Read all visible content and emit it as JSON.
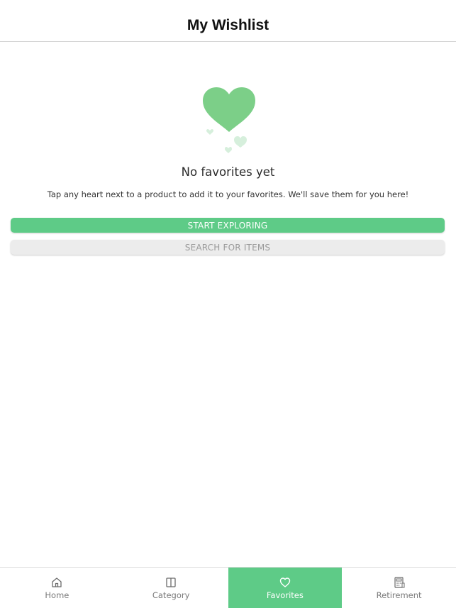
{
  "header": {
    "title": "My Wishlist"
  },
  "empty_state": {
    "title": "No favorites yet",
    "description": "Tap any heart next to a product to add it to your favorites. We'll save them for you here!",
    "heart_color": "#7ccf88"
  },
  "actions": {
    "primary_label": "START EXPLORING",
    "secondary_label": "SEARCH FOR ITEMS"
  },
  "tabbar": {
    "active_color": "#5ecb87",
    "tabs": [
      {
        "label": "Home",
        "icon": "home-icon",
        "active": false
      },
      {
        "label": "Category",
        "icon": "category-icon",
        "active": false
      },
      {
        "label": "Favorites",
        "icon": "heart-icon",
        "active": true
      },
      {
        "label": "Retirement",
        "icon": "calculator-icon",
        "active": false
      }
    ]
  }
}
